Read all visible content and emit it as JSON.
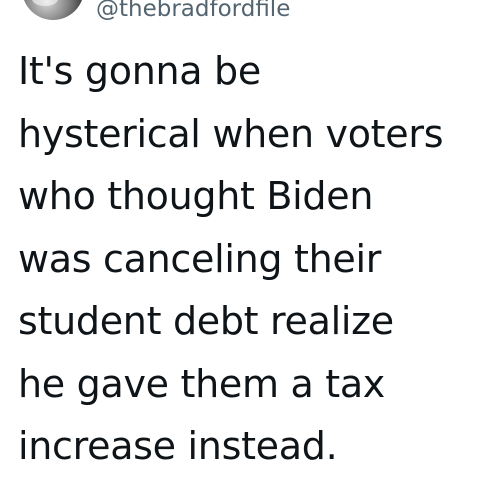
{
  "tweet": {
    "handle": "@thebradfordfile",
    "lines": [
      "It's gonna be",
      "hysterical when voters",
      "who thought Biden",
      "was canceling their",
      "student debt realize",
      "he gave them a tax",
      "increase instead."
    ]
  }
}
